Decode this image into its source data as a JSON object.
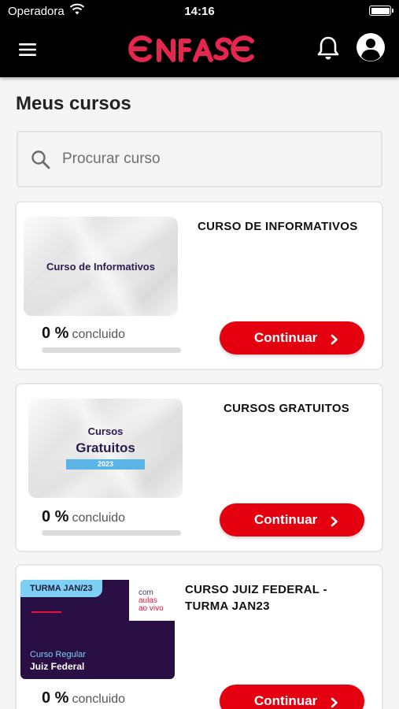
{
  "status_bar": {
    "carrier": "Operadora",
    "time": "14:16"
  },
  "app": {
    "logo_text": "ENFASE",
    "brand_color": "#e5264e",
    "accent_color": "#e4000f",
    "icons": {
      "menu": "hamburger-menu-icon",
      "notifications": "bell-icon",
      "profile": "profile-icon",
      "search": "search-icon",
      "continue": "chevron-right-icon"
    }
  },
  "page": {
    "title": "Meus cursos"
  },
  "search": {
    "placeholder": "Procurar curso",
    "value": ""
  },
  "courses": [
    {
      "title": "CURSO DE INFORMATIVOS",
      "thumbnail": {
        "text": "Curso de Informativos"
      },
      "progress_value": "0 %",
      "progress_fraction": 0,
      "progress_label": "concluido",
      "button_label": "Continuar"
    },
    {
      "title": "CURSOS GRATUITOS",
      "thumbnail": {
        "line1": "Cursos",
        "line2": "Gratuitos",
        "year": "2023"
      },
      "progress_value": "0 %",
      "progress_fraction": 0,
      "progress_label": "concluido",
      "button_label": "Continuar"
    },
    {
      "title": "CURSO JUIZ FEDERAL - TURMA JAN23",
      "thumbnail": {
        "badge": "TURMA JAN/23",
        "tag_line1": "com",
        "tag_line2": "aulas",
        "tag_line3": "ao vivo",
        "line1": "Curso Regular",
        "line2": "Juiz Federal"
      },
      "progress_value": "0 %",
      "progress_fraction": 0,
      "progress_label": "concluido",
      "button_label": "Continuar"
    }
  ]
}
